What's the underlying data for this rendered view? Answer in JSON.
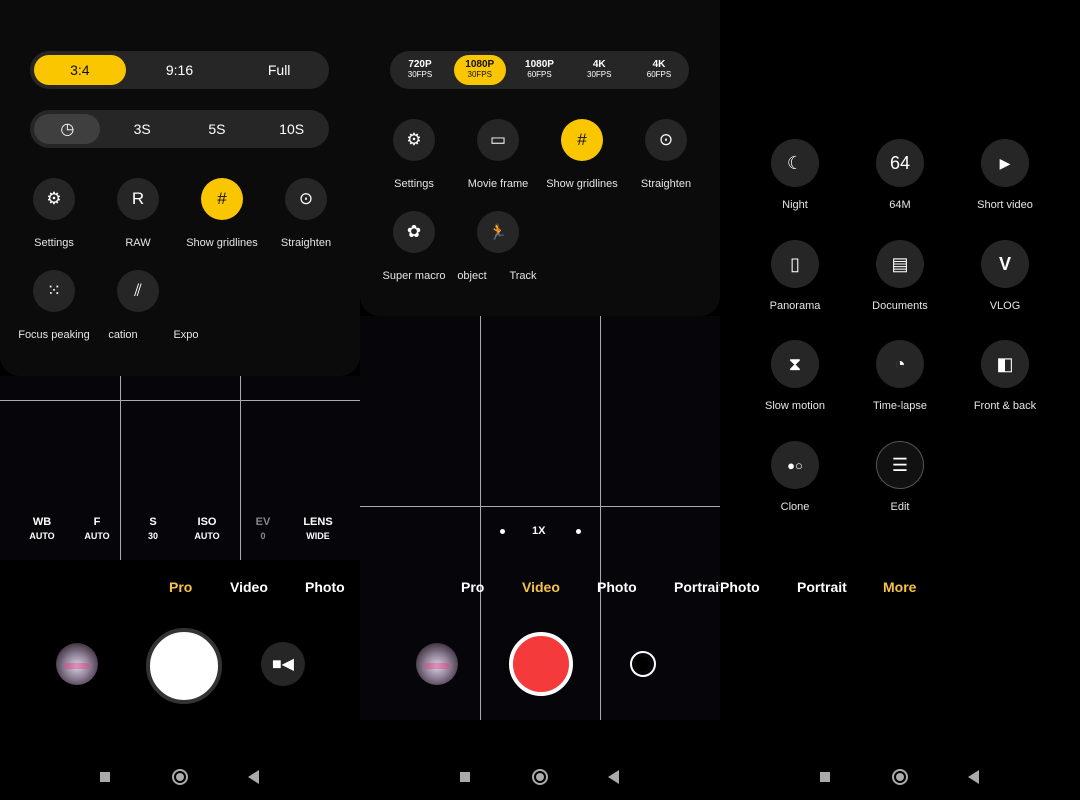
{
  "pro": {
    "aspect_options": [
      {
        "label": "3:4",
        "selected": true
      },
      {
        "label": "9:16",
        "selected": false
      },
      {
        "label": "Full",
        "selected": false
      }
    ],
    "timer_options": [
      {
        "icon": "clock-icon",
        "label": "◷"
      },
      {
        "label": "3S"
      },
      {
        "label": "5S"
      },
      {
        "label": "10S"
      }
    ],
    "tools": [
      {
        "icon": "settings-icon",
        "glyph": "⚙",
        "label": "Settings"
      },
      {
        "icon": "raw-icon",
        "glyph": "R",
        "label": "RAW"
      },
      {
        "icon": "gridlines-icon",
        "glyph": "#",
        "label": "Show gridlines",
        "selected": true
      },
      {
        "icon": "straighten-icon",
        "glyph": "⊙",
        "label": "Straighten"
      },
      {
        "icon": "focus-peaking-icon",
        "glyph": "⁙",
        "label": "Focus peaking"
      },
      {
        "icon": "hatch-icon",
        "glyph": "⫽",
        "label": "cation"
      },
      {
        "icon": "exposure-icon",
        "glyph": "",
        "label": "Expo"
      }
    ],
    "params": [
      {
        "key": "WB",
        "value": "AUTO"
      },
      {
        "key": "F",
        "value": "AUTO"
      },
      {
        "key": "S",
        "value": "30"
      },
      {
        "key": "ISO",
        "value": "AUTO"
      },
      {
        "key": "EV",
        "value": "0"
      },
      {
        "key": "LENS",
        "value": "WIDE"
      }
    ],
    "modes": [
      "Pro",
      "Video",
      "Photo"
    ]
  },
  "video": {
    "resolutions": [
      {
        "res": "720P",
        "fps": "30FPS"
      },
      {
        "res": "1080P",
        "fps": "30FPS",
        "selected": true
      },
      {
        "res": "1080P",
        "fps": "60FPS"
      },
      {
        "res": "4K",
        "fps": "30FPS"
      },
      {
        "res": "4K",
        "fps": "60FPS"
      }
    ],
    "tools": [
      {
        "icon": "settings-icon",
        "glyph": "⚙",
        "label": "Settings"
      },
      {
        "icon": "movie-frame-icon",
        "glyph": "▭",
        "label": "Movie frame"
      },
      {
        "icon": "gridlines-icon",
        "glyph": "#",
        "label": "Show gridlines",
        "selected": true
      },
      {
        "icon": "straighten-icon",
        "glyph": "⊙",
        "label": "Straighten"
      },
      {
        "icon": "super-macro-icon",
        "glyph": "✿",
        "label": "Super macro"
      },
      {
        "icon": "object-icon",
        "glyph": "",
        "label": "object"
      },
      {
        "icon": "track-icon",
        "glyph": "🏃",
        "label": "Track"
      }
    ],
    "zoom": "1X",
    "modes": [
      "Pro",
      "Video",
      "Photo",
      "Portrait"
    ]
  },
  "more": {
    "items": [
      {
        "icon": "night-icon",
        "glyph": "☾",
        "label": "Night"
      },
      {
        "icon": "64m-icon",
        "glyph": "64",
        "label": "64M"
      },
      {
        "icon": "short-video-icon",
        "glyph": "▶",
        "label": "Short video"
      },
      {
        "icon": "panorama-icon",
        "glyph": "▯",
        "label": "Panorama"
      },
      {
        "icon": "documents-icon",
        "glyph": "▤",
        "label": "Documents"
      },
      {
        "icon": "vlog-icon",
        "glyph": "V",
        "label": "VLOG"
      },
      {
        "icon": "slow-motion-icon",
        "glyph": "⧗",
        "label": "Slow motion"
      },
      {
        "icon": "time-lapse-icon",
        "glyph": "◔",
        "label": "Time-lapse"
      },
      {
        "icon": "front-back-icon",
        "glyph": "◧",
        "label": "Front & back"
      },
      {
        "icon": "clone-icon",
        "glyph": "●○",
        "label": "Clone"
      },
      {
        "icon": "edit-icon",
        "glyph": "☰",
        "label": "Edit"
      }
    ],
    "modes": [
      "Photo",
      "Portrait",
      "More"
    ]
  },
  "colors": {
    "accent": "#f9c600",
    "mode_active": "#f6c24a",
    "record": "#f43a3a"
  }
}
